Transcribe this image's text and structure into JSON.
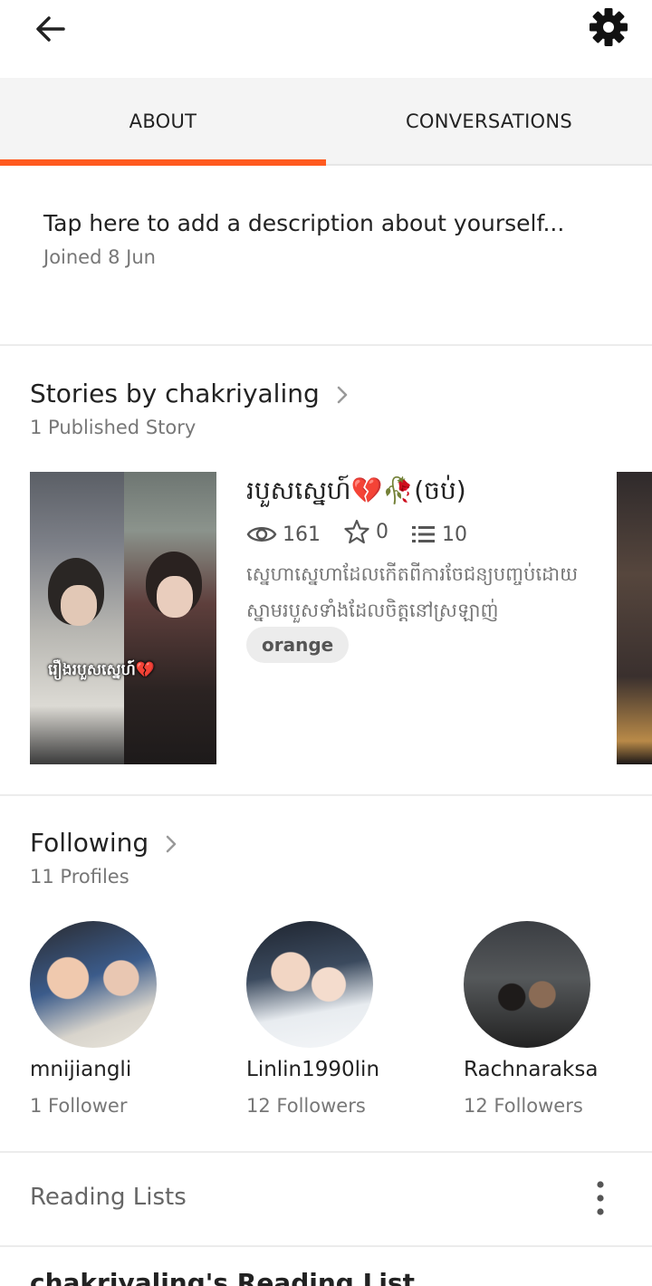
{
  "header": {
    "back_icon": "arrow-left-icon",
    "settings_icon": "gear-icon"
  },
  "tabs": [
    {
      "label": "ABOUT",
      "active": true
    },
    {
      "label": "CONVERSATIONS",
      "active": false
    }
  ],
  "profile": {
    "description_placeholder": "Tap here to add a description about yourself...",
    "joined": "Joined 8 Jun"
  },
  "stories": {
    "title": "Stories by chakriyaling",
    "subtitle": "1 Published Story",
    "items": [
      {
        "cover_text": "រឿងរបួសស្នេហ៍💔",
        "title": "របួសស្នេហ៍💔🥀(ចប់)",
        "views": "161",
        "votes": "0",
        "parts": "10",
        "description": "ស្នេហាស្នេហាដែលកើតពីការចែជន្យបញ្ចប់ដោយស្នាមរបួសទាំងដែលចិត្តនៅស្រឡាញ់",
        "tag": "orange"
      }
    ]
  },
  "following": {
    "title": "Following",
    "subtitle": "11 Profiles",
    "profiles": [
      {
        "name": "mnijiangli",
        "followers": "1 Follower"
      },
      {
        "name": "Linlin1990lin",
        "followers": "12 Followers"
      },
      {
        "name": "Rachnaraksa",
        "followers": "12 Followers"
      }
    ]
  },
  "reading_lists": {
    "label": "Reading Lists",
    "menu_icon": "more-vertical-icon",
    "next_title_partial": "chakriyaling's Reading List"
  },
  "colors": {
    "accent": "#ff5a1f"
  }
}
